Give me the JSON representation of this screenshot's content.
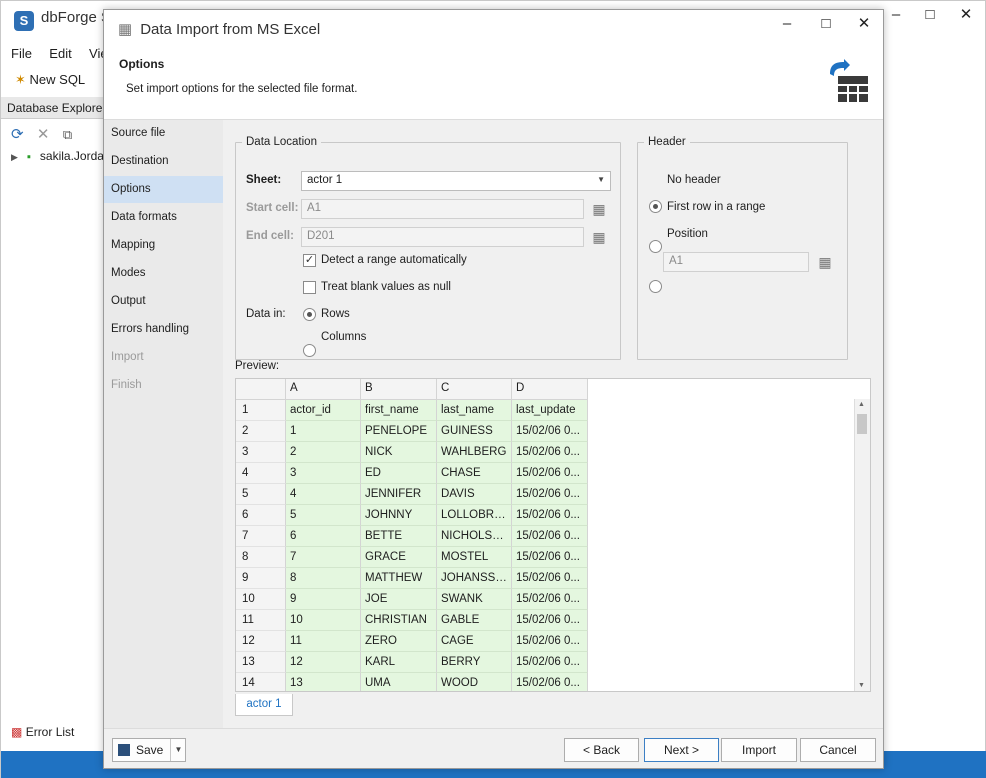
{
  "main_window": {
    "title": "dbForge S",
    "menu": [
      "File",
      "Edit",
      "View"
    ],
    "toolbar_new_sql": "New SQL",
    "db_explorer_tab": "Database Explorer",
    "tree_item": "sakila.Jorda",
    "error_list": "Error List",
    "status_color": "#1f72c2"
  },
  "dialog": {
    "title": "Data Import from MS Excel",
    "header_title": "Options",
    "header_subtitle": "Set import options for the selected file format.",
    "steps": [
      {
        "label": "Source file",
        "state": "normal"
      },
      {
        "label": "Destination",
        "state": "normal"
      },
      {
        "label": "Options",
        "state": "active"
      },
      {
        "label": "Data formats",
        "state": "normal"
      },
      {
        "label": "Mapping",
        "state": "normal"
      },
      {
        "label": "Modes",
        "state": "normal"
      },
      {
        "label": "Output",
        "state": "normal"
      },
      {
        "label": "Errors handling",
        "state": "normal"
      },
      {
        "label": "Import",
        "state": "disabled"
      },
      {
        "label": "Finish",
        "state": "disabled"
      }
    ],
    "data_location": {
      "legend": "Data Location",
      "sheet_label": "Sheet:",
      "sheet_value": "actor 1",
      "start_cell_label": "Start cell:",
      "start_cell_value": "A1",
      "end_cell_label": "End cell:",
      "end_cell_value": "D201",
      "detect_range_label": "Detect a range automatically",
      "detect_range_checked": true,
      "blank_null_label": "Treat blank values as null",
      "blank_null_checked": false,
      "data_in_label": "Data in:",
      "rows_label": "Rows",
      "columns_label": "Columns",
      "data_in_selected": "rows"
    },
    "header_group": {
      "legend": "Header",
      "no_header_label": "No header",
      "first_row_label": "First row in a range",
      "position_label": "Position",
      "position_value": "A1",
      "selected": "no_header"
    },
    "preview": {
      "label": "Preview:",
      "columns": [
        "A",
        "B",
        "C",
        "D"
      ],
      "rows": [
        [
          "1",
          "actor_id",
          "first_name",
          "last_name",
          "last_update"
        ],
        [
          "2",
          "1",
          "PENELOPE",
          "GUINESS",
          "15/02/06 0..."
        ],
        [
          "3",
          "2",
          "NICK",
          "WAHLBERG",
          "15/02/06 0..."
        ],
        [
          "4",
          "3",
          "ED",
          "CHASE",
          "15/02/06 0..."
        ],
        [
          "5",
          "4",
          "JENNIFER",
          "DAVIS",
          "15/02/06 0..."
        ],
        [
          "6",
          "5",
          "JOHNNY",
          "LOLLOBRIG...",
          "15/02/06 0..."
        ],
        [
          "7",
          "6",
          "BETTE",
          "NICHOLSON",
          "15/02/06 0..."
        ],
        [
          "8",
          "7",
          "GRACE",
          "MOSTEL",
          "15/02/06 0..."
        ],
        [
          "9",
          "8",
          "MATTHEW",
          "JOHANSSON",
          "15/02/06 0..."
        ],
        [
          "10",
          "9",
          "JOE",
          "SWANK",
          "15/02/06 0..."
        ],
        [
          "11",
          "10",
          "CHRISTIAN",
          "GABLE",
          "15/02/06 0..."
        ],
        [
          "12",
          "11",
          "ZERO",
          "CAGE",
          "15/02/06 0..."
        ],
        [
          "13",
          "12",
          "KARL",
          "BERRY",
          "15/02/06 0..."
        ],
        [
          "14",
          "13",
          "UMA",
          "WOOD",
          "15/02/06 0..."
        ]
      ],
      "sheet_tab": "actor 1"
    },
    "footer": {
      "save": "Save",
      "back": "< Back",
      "next": "Next >",
      "import": "Import",
      "cancel": "Cancel"
    }
  }
}
